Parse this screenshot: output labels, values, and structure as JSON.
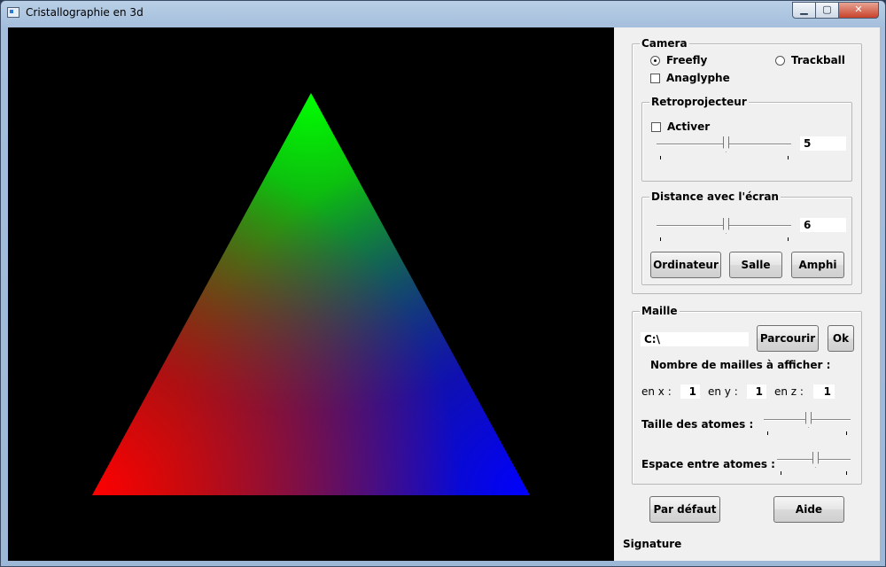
{
  "window": {
    "title": "Cristallographie en 3d",
    "buttons": {
      "minimize": "▁",
      "maximize": "▢",
      "close": "✕"
    }
  },
  "viewport": {
    "background": "#000000"
  },
  "camera": {
    "title": "Camera",
    "mode_freefly": "Freefly",
    "mode_trackball": "Trackball",
    "selected_mode": "Freefly",
    "anaglyphe_label": "Anaglyphe",
    "anaglyphe_checked": false,
    "retroprojecteur": {
      "title": "Retroprojecteur",
      "activer_label": "Activer",
      "activer_checked": false,
      "value": "5"
    },
    "distance": {
      "title": "Distance avec l'écran",
      "value": "6",
      "btn_ordinateur": "Ordinateur",
      "btn_salle": "Salle",
      "btn_amphi": "Amphi"
    }
  },
  "maille": {
    "title": "Maille",
    "path_value": "C:\\",
    "btn_parcourir": "Parcourir",
    "btn_ok": "Ok",
    "count_label": "Nombre de mailles à afficher :",
    "x_label": "en x :",
    "x_value": "1",
    "y_label": "en y :",
    "y_value": "1",
    "z_label": "en z :",
    "z_value": "1",
    "taille_label": "Taille des atomes :",
    "espace_label": "Espace entre atomes :"
  },
  "footer": {
    "btn_defaut": "Par défaut",
    "btn_aide": "Aide",
    "signature": "Signature"
  }
}
